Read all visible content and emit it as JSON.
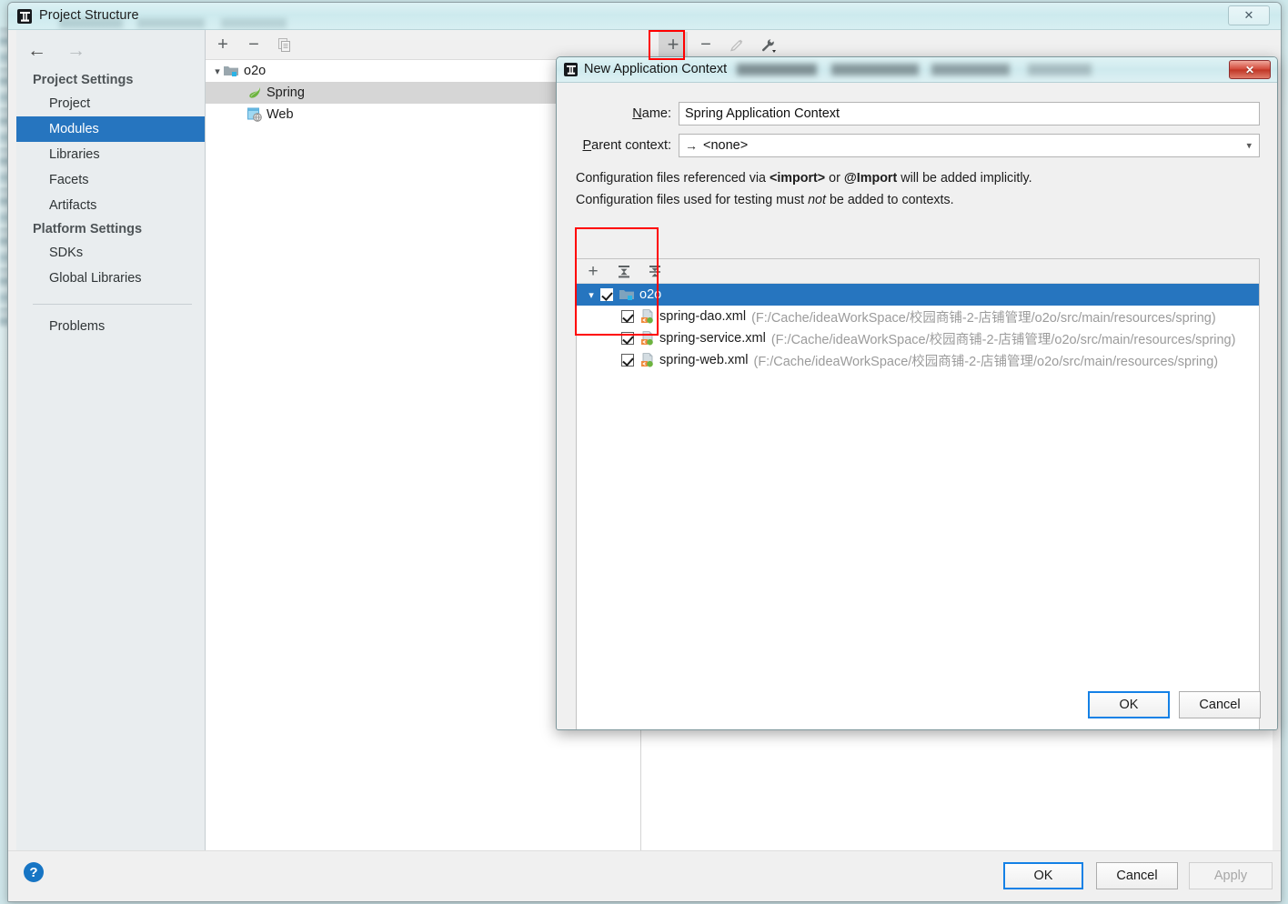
{
  "main_window": {
    "title": "Project Structure",
    "icon": "intellij-idea-icon",
    "close_label": "✕"
  },
  "sidebar": {
    "back_icon": "arrow-left-icon",
    "forward_icon": "arrow-right-icon",
    "groups": [
      {
        "label": "Project Settings",
        "items": [
          {
            "label": "Project",
            "selected": false
          },
          {
            "label": "Modules",
            "selected": true
          },
          {
            "label": "Libraries",
            "selected": false
          },
          {
            "label": "Facets",
            "selected": false
          },
          {
            "label": "Artifacts",
            "selected": false
          }
        ]
      },
      {
        "label": "Platform Settings",
        "items": [
          {
            "label": "SDKs",
            "selected": false
          },
          {
            "label": "Global Libraries",
            "selected": false
          }
        ]
      }
    ],
    "extra_items": [
      {
        "label": "Problems",
        "selected": false
      }
    ]
  },
  "modules_toolbar": {
    "add_label": "+",
    "remove_label": "−",
    "copy_icon": "copy-icon"
  },
  "modules_tree": {
    "rows": [
      {
        "label": "o2o",
        "icon": "module-folder-icon",
        "indent": 0,
        "expanded": true,
        "selected": false
      },
      {
        "label": "Spring",
        "icon": "spring-leaf-icon",
        "indent": 1,
        "expanded": null,
        "selected": true
      },
      {
        "label": "Web",
        "icon": "web-facet-icon",
        "indent": 1,
        "expanded": null,
        "selected": false
      }
    ]
  },
  "facet_toolbar": {
    "add_label": "+",
    "remove_label": "−",
    "edit_icon": "pencil-icon",
    "wrench_icon": "wrench-dropdown-icon",
    "highlighted": "add_label"
  },
  "dialog": {
    "title": "New Application Context",
    "icon": "intellij-idea-icon",
    "close_label": "✕",
    "name_field": {
      "label": "Name:",
      "label_mnemonic": "N",
      "value": "Spring Application Context",
      "placeholder": ""
    },
    "parent_context": {
      "label": "Parent context:",
      "label_mnemonic": "P",
      "value": "<none>",
      "value_icon": "arrow-right-icon",
      "caret_icon": "chevron-down-icon",
      "options": [
        "<none>"
      ]
    },
    "notes": [
      {
        "parts": [
          {
            "text": "Configuration files referenced via ",
            "style": "normal"
          },
          {
            "text": "<import>",
            "style": "bold"
          },
          {
            "text": " or ",
            "style": "normal"
          },
          {
            "text": "@Import",
            "style": "bold"
          },
          {
            "text": " will be added implicitly.",
            "style": "normal"
          }
        ]
      },
      {
        "parts": [
          {
            "text": "Configuration files used for testing must ",
            "style": "normal"
          },
          {
            "text": "not",
            "style": "italic"
          },
          {
            "text": " be added to contexts.",
            "style": "normal"
          }
        ]
      }
    ],
    "file_toolbar": {
      "add_label": "+",
      "expand_all_icon": "expand-all-icon",
      "collapse_all_icon": "collapse-all-icon"
    },
    "file_tree": {
      "rows": [
        {
          "name": "o2o",
          "path": "",
          "icon": "module-folder-icon",
          "indent": 0,
          "checked": true,
          "expanded": true,
          "selected": true
        },
        {
          "name": "spring-dao.xml",
          "path": "(F:/Cache/ideaWorkSpace/校园商铺-2-店铺管理/o2o/src/main/resources/spring)",
          "icon": "spring-config-xml-icon",
          "indent": 1,
          "checked": true,
          "expanded": null,
          "selected": false
        },
        {
          "name": "spring-service.xml",
          "path": "(F:/Cache/ideaWorkSpace/校园商铺-2-店铺管理/o2o/src/main/resources/spring)",
          "icon": "spring-config-xml-icon",
          "indent": 1,
          "checked": true,
          "expanded": null,
          "selected": false
        },
        {
          "name": "spring-web.xml",
          "path": "(F:/Cache/ideaWorkSpace/校园商铺-2-店铺管理/o2o/src/main/resources/spring)",
          "icon": "spring-config-xml-icon",
          "indent": 1,
          "checked": true,
          "expanded": null,
          "selected": false
        }
      ]
    },
    "buttons": {
      "ok": "OK",
      "cancel": "Cancel"
    }
  },
  "main_buttons": {
    "help": "?",
    "ok": "OK",
    "cancel": "Cancel",
    "apply": "Apply",
    "apply_disabled": true
  },
  "colors": {
    "selection_blue": "#2675bf",
    "annotation_red": "#ff0000",
    "accent_button_border": "#1481e6",
    "close_red": "#c03626",
    "help_blue": "#1775c4"
  }
}
